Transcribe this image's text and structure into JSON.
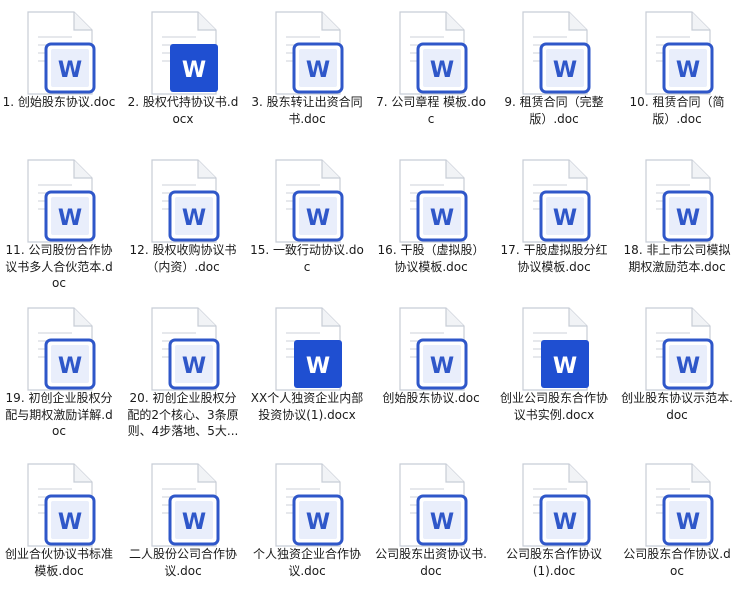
{
  "files": [
    {
      "name": "1. 创始股东协议.doc",
      "type": "doc"
    },
    {
      "name": "2. 股权代持协议书.docx",
      "type": "docx"
    },
    {
      "name": "3. 股东转让出资合同书.doc",
      "type": "doc"
    },
    {
      "name": "7. 公司章程 模板.doc",
      "type": "doc"
    },
    {
      "name": "9. 租赁合同（完整版）.doc",
      "type": "doc"
    },
    {
      "name": "10. 租赁合同（简版）.doc",
      "type": "doc"
    },
    {
      "name": "11. 公司股份合作协议书多人合伙范本.doc",
      "type": "doc"
    },
    {
      "name": "12. 股权收购协议书（内资）.doc",
      "type": "doc"
    },
    {
      "name": "15. 一致行动协议.doc",
      "type": "doc"
    },
    {
      "name": "16. 干股（虚拟股）协议模板.doc",
      "type": "doc"
    },
    {
      "name": "17. 干股虚拟股分红协议模板.doc",
      "type": "doc"
    },
    {
      "name": "18. 非上市公司模拟期权激励范本.doc",
      "type": "doc"
    },
    {
      "name": "19. 初创企业股权分配与期权激励详解.doc",
      "type": "doc"
    },
    {
      "name": "20. 初创企业股权分配的2个核心、3条原则、4步落地、5大...",
      "type": "doc"
    },
    {
      "name": "XX个人独资企业内部投资协议(1).docx",
      "type": "docx"
    },
    {
      "name": "创始股东协议.doc",
      "type": "doc"
    },
    {
      "name": "创业公司股东合作协议书实例.docx",
      "type": "docx"
    },
    {
      "name": "创业股东协议示范本.doc",
      "type": "doc"
    },
    {
      "name": "创业合伙协议书标准模板.doc",
      "type": "doc"
    },
    {
      "name": "二人股份公司合作协议.doc",
      "type": "doc"
    },
    {
      "name": "个人独资企业合作协议.doc",
      "type": "doc"
    },
    {
      "name": "公司股东出资协议书.doc",
      "type": "doc"
    },
    {
      "name": "公司股东合作协议(1).doc",
      "type": "doc"
    },
    {
      "name": "公司股东合作协议.doc",
      "type": "doc"
    }
  ],
  "icon": {
    "letter": "W",
    "doc_badge_color": "#2f57c9",
    "docx_badge_color": "#1f4fd1",
    "page_color": "#ffffff",
    "page_border": "#c8cdd6",
    "line_color": "#e6e8ec",
    "badge_icon_name": "word-document-icon"
  }
}
